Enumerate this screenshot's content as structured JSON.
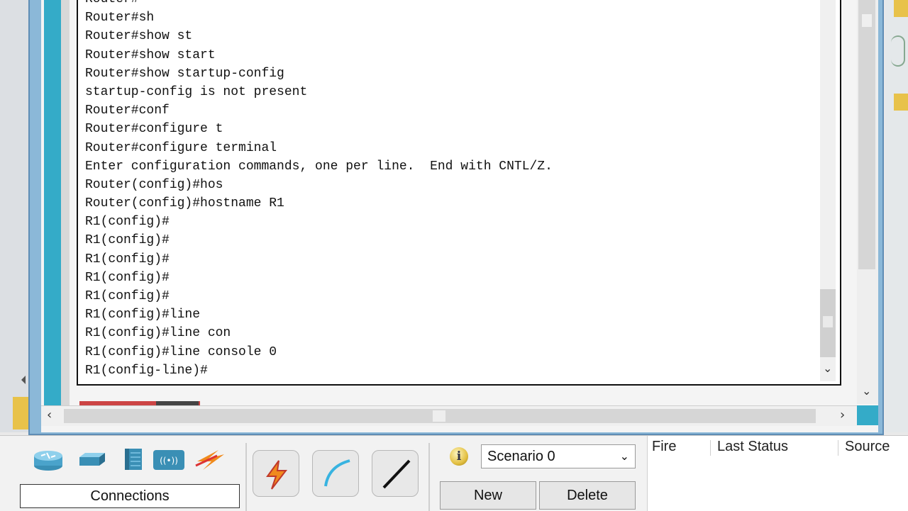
{
  "terminal": {
    "lines": [
      "Router#",
      "Router#sh",
      "Router#show st",
      "Router#show start",
      "Router#show startup-config",
      "startup-config is not present",
      "Router#conf",
      "Router#configure t",
      "Router#configure terminal",
      "Enter configuration commands, one per line.  End with CNTL/Z.",
      "Router(config)#hos",
      "Router(config)#hostname R1",
      "R1(config)#",
      "R1(config)#",
      "R1(config)#",
      "R1(config)#",
      "R1(config)#",
      "R1(config)#line",
      "R1(config)#line con",
      "R1(config)#line console 0",
      "R1(config-line)#"
    ]
  },
  "toolbar": {
    "connections_label": "Connections",
    "device_icons": [
      "router-icon",
      "switch-icon",
      "hub-icon",
      "wireless-icon",
      "connection-icon"
    ],
    "tool_buttons": [
      "auto-connection-icon",
      "console-cable-icon",
      "straight-through-cable-icon"
    ]
  },
  "scenario": {
    "selected": "Scenario 0",
    "new_label": "New",
    "delete_label": "Delete"
  },
  "pdu_table": {
    "columns": [
      "Fire",
      "Last Status",
      "Source"
    ]
  },
  "colors": {
    "accent": "#34abc8",
    "frame": "#8bb8d8"
  }
}
